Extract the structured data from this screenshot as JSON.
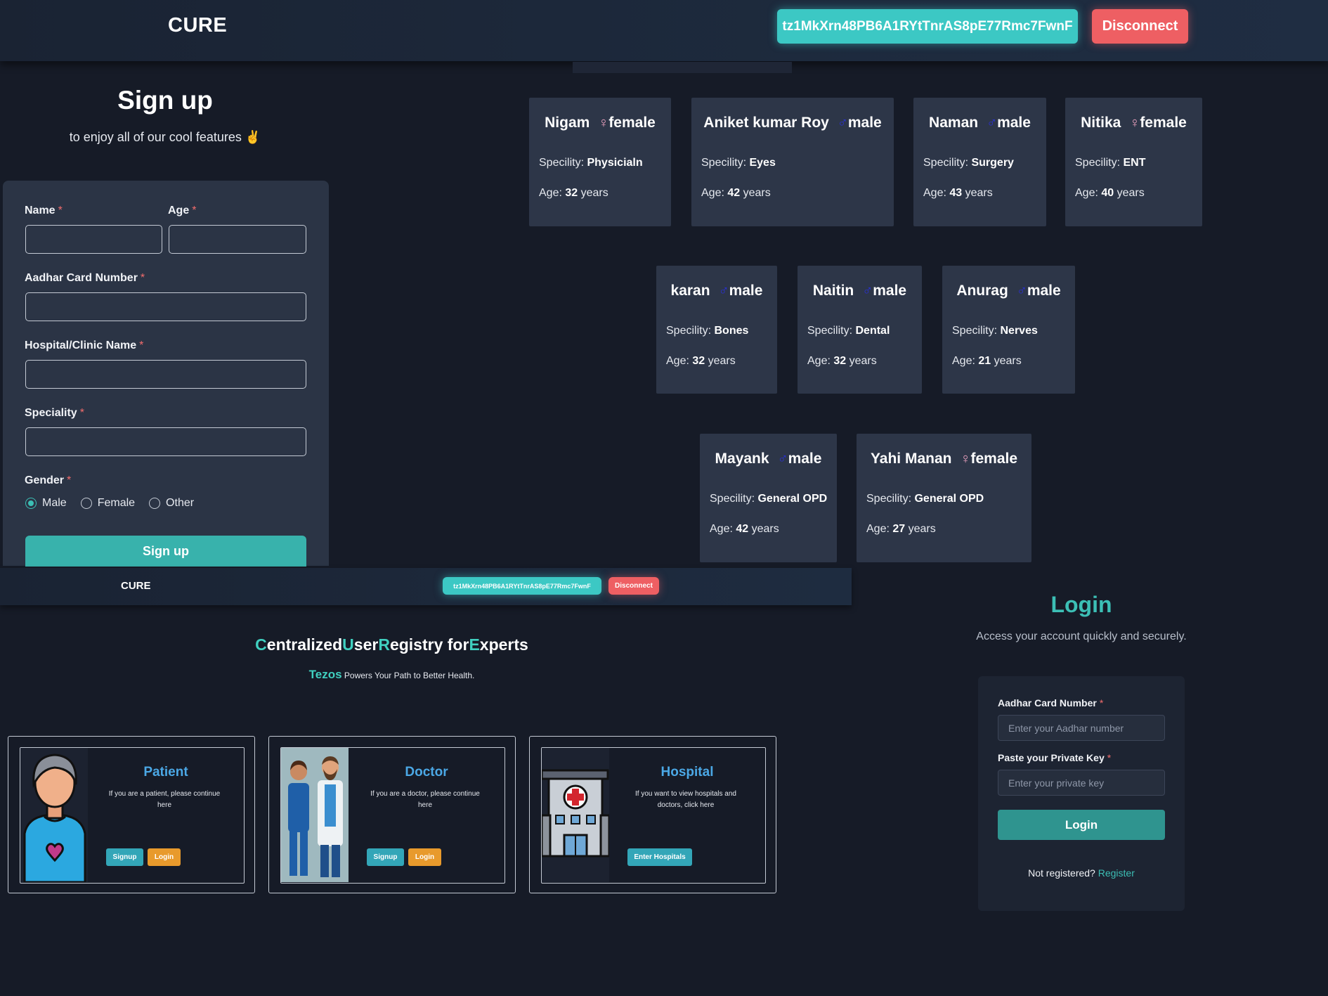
{
  "top_header": {
    "logo": "CURE",
    "wallet_address": "tz1MkXrn48PB6A1RYtTnrAS8pE77Rmc7FwnF",
    "disconnect_label": "Disconnect"
  },
  "signup": {
    "title": "Sign up",
    "subtitle": "to enjoy all of our cool features ✌️",
    "required_mark": "*",
    "fields": {
      "name": "Name",
      "age": "Age",
      "aadhar": "Aadhar Card Number",
      "hospital": "Hospital/Clinic Name",
      "speciality": "Speciality",
      "gender": "Gender"
    },
    "gender_options": [
      "Male",
      "Female",
      "Other"
    ],
    "gender_selected": "Male",
    "submit_label": "Sign up"
  },
  "doctors": [
    {
      "name": "Nigam",
      "gender_symbol": "♀",
      "gender": "female",
      "spec_label": "Specility:",
      "speciality": "Physicialn",
      "age_label": "Age:",
      "age": "32",
      "age_unit": "years"
    },
    {
      "name": "Aniket kumar Roy",
      "gender_symbol": "♂",
      "gender": "male",
      "spec_label": "Specility:",
      "speciality": "Eyes",
      "age_label": "Age:",
      "age": "42",
      "age_unit": "years"
    },
    {
      "name": "Naman",
      "gender_symbol": "♂",
      "gender": "male",
      "spec_label": "Specility:",
      "speciality": "Surgery",
      "age_label": "Age:",
      "age": "43",
      "age_unit": "years"
    },
    {
      "name": "Nitika",
      "gender_symbol": "♀",
      "gender": "female",
      "spec_label": "Specility:",
      "speciality": "ENT",
      "age_label": "Age:",
      "age": "40",
      "age_unit": "years"
    },
    {
      "name": "karan",
      "gender_symbol": "♂",
      "gender": "male",
      "spec_label": "Specility:",
      "speciality": "Bones",
      "age_label": "Age:",
      "age": "32",
      "age_unit": "years"
    },
    {
      "name": "Naitin",
      "gender_symbol": "♂",
      "gender": "male",
      "spec_label": "Specility:",
      "speciality": "Dental",
      "age_label": "Age:",
      "age": "32",
      "age_unit": "years"
    },
    {
      "name": "Anurag",
      "gender_symbol": "♂",
      "gender": "male",
      "spec_label": "Specility:",
      "speciality": "Nerves",
      "age_label": "Age:",
      "age": "21",
      "age_unit": "years"
    },
    {
      "name": "Mayank",
      "gender_symbol": "♂",
      "gender": "male",
      "spec_label": "Specility:",
      "speciality": "General OPD",
      "age_label": "Age:",
      "age": "42",
      "age_unit": "years"
    },
    {
      "name": "Yahi Manan",
      "gender_symbol": "♀",
      "gender": "female",
      "spec_label": "Specility:",
      "speciality": "General OPD",
      "age_label": "Age:",
      "age": "27",
      "age_unit": "years"
    }
  ],
  "bottom_header": {
    "logo": "CURE",
    "wallet_address": "tz1MkXrn48PB6A1RYtTnrAS8pE77Rmc7FwnF",
    "disconnect_label": "Disconnect"
  },
  "home": {
    "title_parts": [
      {
        "text": "C",
        "hl": true
      },
      {
        "text": "entralized",
        "hl": false
      },
      {
        "text": "U",
        "hl": true
      },
      {
        "text": "ser",
        "hl": false
      },
      {
        "text": "R",
        "hl": true
      },
      {
        "text": "egistry for",
        "hl": false
      },
      {
        "text": "E",
        "hl": true
      },
      {
        "text": "xperts",
        "hl": false
      }
    ],
    "tezos_word": "Tezos",
    "tezos_rest": "Powers Your Path to Better Health.",
    "roles": [
      {
        "title": "Patient",
        "desc": "If you are a patient, please continue here",
        "buttons": [
          "Signup",
          "Login"
        ]
      },
      {
        "title": "Doctor",
        "desc": "If you are a doctor, please continue here",
        "buttons": [
          "Signup",
          "Login"
        ]
      },
      {
        "title": "Hospital",
        "desc": "If you want to view hospitals and doctors, click here",
        "buttons": [
          "Enter Hospitals"
        ]
      }
    ]
  },
  "login": {
    "title": "Login",
    "subtitle": "Access your account quickly and securely.",
    "aadhar_label": "Aadhar Card Number",
    "aadhar_placeholder": "Enter your Aadhar number",
    "key_label": "Paste your Private Key",
    "key_placeholder": "Enter your private key",
    "submit_label": "Login",
    "footer_text": "Not registered?",
    "register_link": "Register"
  },
  "colors": {
    "accent_teal": "#38b2ac",
    "danger": "#ee5f63",
    "role_title_blue": "#4ba8e6",
    "male_symbol": "#2a30d8",
    "female_symbol": "#f2a5c3"
  }
}
